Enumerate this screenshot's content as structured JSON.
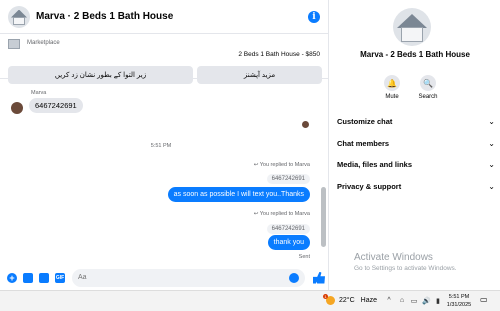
{
  "header": {
    "title": "Marva · 2 Beds 1 Bath House",
    "info_icon": "info-icon",
    "info_glyph": "i"
  },
  "listing": {
    "source": "Marketplace",
    "title": "2 Beds 1 Bath House - $850",
    "more_options_label": "مزید آپشنز",
    "mark_pending_label": "زیر التوا کے بطور نشان زد کریں"
  },
  "messages": {
    "incoming_sender": "Marva",
    "incoming_text": "6467242691",
    "timestamp": "5:51 PM",
    "reply1_note": "You replied to Marva",
    "reply1_quote": "6467242691",
    "reply1_text": "as soon as possible I will text you..Thanks",
    "reply2_note": "You replied to Marva",
    "reply2_quote": "6467242691",
    "reply2_text": "thank you",
    "status": "Sent"
  },
  "composer": {
    "placeholder": "Aa",
    "plus_glyph": "+",
    "gif_label": "GIF"
  },
  "info_panel": {
    "name": "Marva - 2 Beds 1 Bath House",
    "mute_label": "Mute",
    "search_label": "Search",
    "mute_glyph": "🔔",
    "search_glyph": "🔍",
    "sections": [
      {
        "label": "Customize chat"
      },
      {
        "label": "Chat members"
      },
      {
        "label": "Media, files and links"
      },
      {
        "label": "Privacy & support"
      }
    ],
    "chevron_glyph": "⌄",
    "watermark_title": "Activate Windows",
    "watermark_sub": "Go to Settings to activate Windows."
  },
  "taskbar": {
    "weather_temp": "22°C",
    "weather_desc": "Haze",
    "weather_badge": "1",
    "time": "5:51 PM",
    "date": "1/31/2025",
    "tray_glyphs": [
      "^",
      "⌂",
      "▭",
      "🔊",
      "▮"
    ],
    "notification_glyph": "▭"
  },
  "colors": {
    "accent": "#0a7cff",
    "bubble_in": "#e4e6eb",
    "muted_text": "#65676b"
  }
}
